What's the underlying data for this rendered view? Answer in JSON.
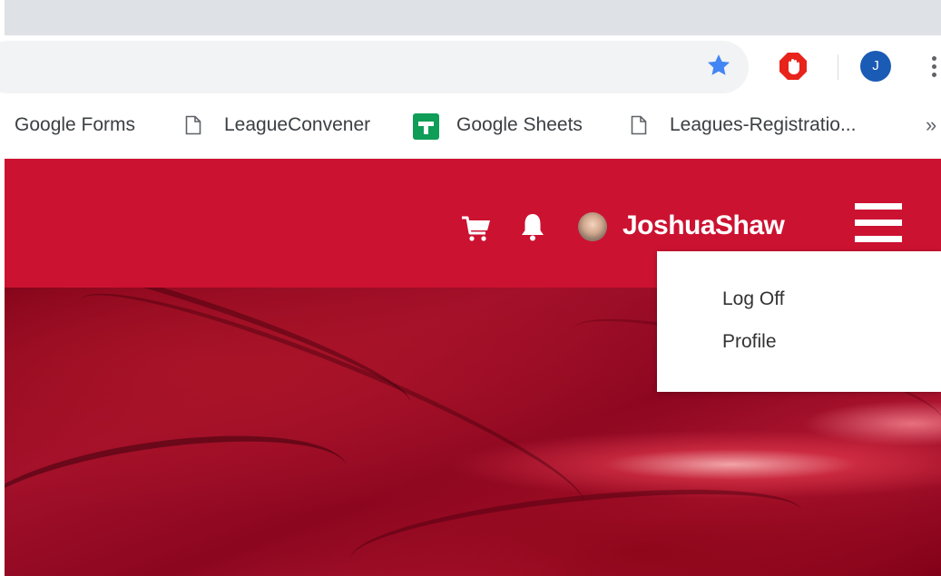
{
  "browser": {
    "profile_initial": "J",
    "bookmarks": [
      {
        "label": "Google Forms",
        "icon": "none"
      },
      {
        "label": "LeagueConvener",
        "icon": "page-icon"
      },
      {
        "label": "Google Sheets",
        "icon": "google-sheets-icon"
      },
      {
        "label": "Leagues-Registratio...",
        "icon": "page-icon"
      }
    ],
    "overflow_label": "»",
    "accent_star": "#4285f4"
  },
  "site": {
    "brand_color": "#cc1231",
    "username": "JoshuaShaw",
    "menu": {
      "items": [
        "Log Off",
        "Profile"
      ]
    }
  }
}
